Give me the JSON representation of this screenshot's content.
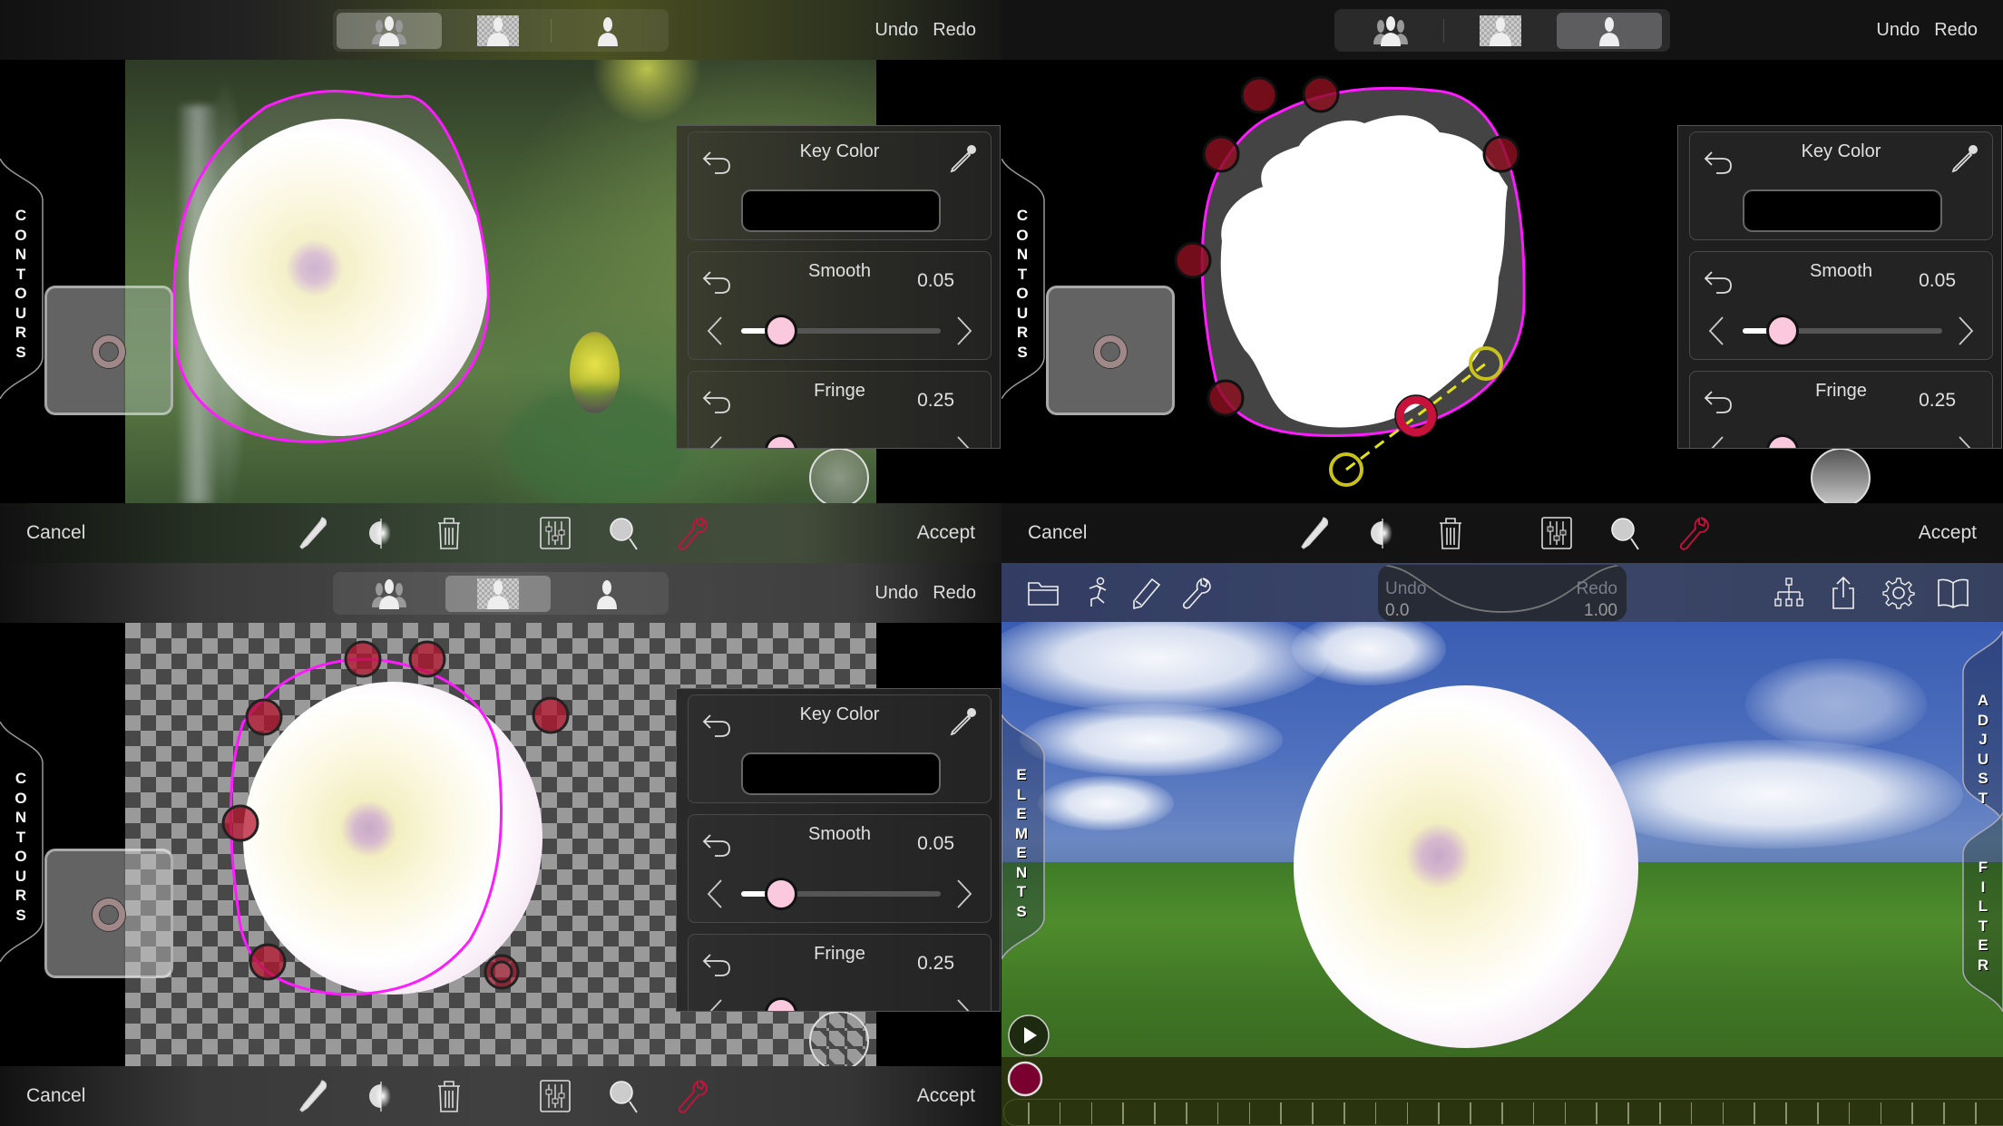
{
  "editor_views": [
    {
      "id": "blurred-preview",
      "segmented_control": {
        "selected": 0,
        "options": [
          {
            "icon": "layered-persons-icon",
            "label": "Composite view"
          },
          {
            "icon": "person-transparent-icon",
            "label": "Cutout view"
          },
          {
            "icon": "person-mask-icon",
            "label": "Mask view"
          }
        ]
      },
      "undo_label": "Undo",
      "redo_label": "Redo",
      "side_tab": "CONTOURS",
      "panel": {
        "key_color": {
          "title": "Key Color",
          "color": "#000000"
        },
        "smooth": {
          "title": "Smooth",
          "value": "0.05",
          "fraction": 0.2
        },
        "fringe": {
          "title": "Fringe",
          "value": "0.25",
          "fraction": 0.2
        }
      },
      "bottom": {
        "cancel": "Cancel",
        "accept": "Accept"
      }
    },
    {
      "id": "mask-view",
      "segmented_control": {
        "selected": 2
      },
      "undo_label": "Undo",
      "redo_label": "Redo",
      "side_tab": "CONTOURS",
      "panel": {
        "key_color": {
          "title": "Key Color",
          "color": "#000000"
        },
        "smooth": {
          "title": "Smooth",
          "value": "0.05",
          "fraction": 0.2
        },
        "fringe": {
          "title": "Fringe",
          "value": "0.25",
          "fraction": 0.2
        }
      },
      "bottom": {
        "cancel": "Cancel",
        "accept": "Accept"
      }
    },
    {
      "id": "cutout-view",
      "segmented_control": {
        "selected": 1
      },
      "undo_label": "Undo",
      "redo_label": "Redo",
      "side_tab": "CONTOURS",
      "panel": {
        "key_color": {
          "title": "Key Color",
          "color": "#000000"
        },
        "smooth": {
          "title": "Smooth",
          "value": "0.05",
          "fraction": 0.2
        },
        "fringe": {
          "title": "Fringe",
          "value": "0.25",
          "fraction": 0.2
        }
      },
      "bottom": {
        "cancel": "Cancel",
        "accept": "Accept"
      }
    }
  ],
  "bottom_tools": [
    {
      "icon": "eyedropper-icon"
    },
    {
      "icon": "half-circle-contrast-icon"
    },
    {
      "icon": "trash-icon"
    },
    {
      "icon": "sliders-icon"
    },
    {
      "icon": "magnifier-icon"
    },
    {
      "icon": "wrench-icon",
      "active": true
    }
  ],
  "composer": {
    "toolbar_left": [
      "folder-icon",
      "running-figure-icon",
      "pencil-icon",
      "wrench-icon"
    ],
    "toolbar_right": [
      "hierarchy-icon",
      "share-icon",
      "gear-icon",
      "book-icon"
    ],
    "undo_label": "Undo",
    "redo_label": "Redo",
    "undo_value": "0.0",
    "redo_value": "1.00",
    "left_tab": "ELEMENTS",
    "right_tabs": [
      "ADJUST",
      "FILTER"
    ]
  },
  "colors": {
    "accent_active": "#c8123c",
    "contour": "#ff1aff",
    "control_point": "#8a1020",
    "slider_thumb": "#fbc9de",
    "record": "#7a0030",
    "handle": "#c8c21a"
  }
}
